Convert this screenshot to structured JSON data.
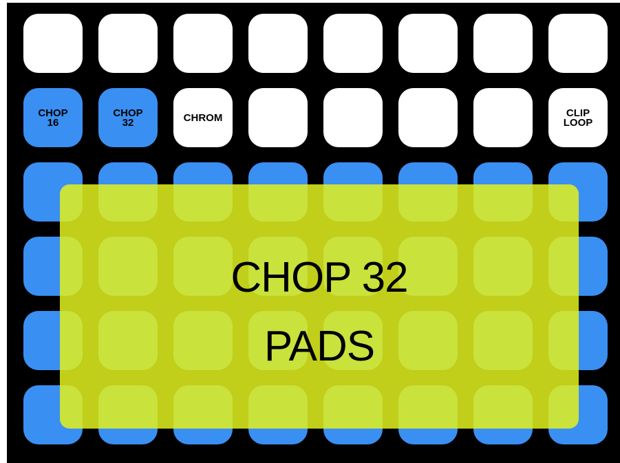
{
  "colors": {
    "background": "#000000",
    "pad_white": "#ffffff",
    "pad_blue": "#3a8ff2",
    "overlay": "#e1f01e"
  },
  "grid": {
    "columns": 8,
    "rows": 6,
    "pads": [
      [
        {
          "label": "",
          "color": "white"
        },
        {
          "label": "",
          "color": "white"
        },
        {
          "label": "",
          "color": "white"
        },
        {
          "label": "",
          "color": "white"
        },
        {
          "label": "",
          "color": "white"
        },
        {
          "label": "",
          "color": "white"
        },
        {
          "label": "",
          "color": "white"
        },
        {
          "label": "",
          "color": "white"
        }
      ],
      [
        {
          "label": "CHOP\n16",
          "color": "blue"
        },
        {
          "label": "CHOP\n32",
          "color": "blue"
        },
        {
          "label": "CHROM",
          "color": "white"
        },
        {
          "label": "",
          "color": "white"
        },
        {
          "label": "",
          "color": "white"
        },
        {
          "label": "",
          "color": "white"
        },
        {
          "label": "",
          "color": "white"
        },
        {
          "label": "CLIP\nLOOP",
          "color": "white"
        }
      ],
      [
        {
          "label": "",
          "color": "blue"
        },
        {
          "label": "",
          "color": "blue"
        },
        {
          "label": "",
          "color": "blue"
        },
        {
          "label": "",
          "color": "blue"
        },
        {
          "label": "",
          "color": "blue"
        },
        {
          "label": "",
          "color": "blue"
        },
        {
          "label": "",
          "color": "blue"
        },
        {
          "label": "",
          "color": "blue"
        }
      ],
      [
        {
          "label": "",
          "color": "blue"
        },
        {
          "label": "",
          "color": "blue"
        },
        {
          "label": "",
          "color": "blue"
        },
        {
          "label": "",
          "color": "blue"
        },
        {
          "label": "",
          "color": "blue"
        },
        {
          "label": "",
          "color": "blue"
        },
        {
          "label": "",
          "color": "blue"
        },
        {
          "label": "",
          "color": "blue"
        }
      ],
      [
        {
          "label": "",
          "color": "blue"
        },
        {
          "label": "",
          "color": "blue"
        },
        {
          "label": "",
          "color": "blue"
        },
        {
          "label": "",
          "color": "blue"
        },
        {
          "label": "",
          "color": "blue"
        },
        {
          "label": "",
          "color": "blue"
        },
        {
          "label": "",
          "color": "blue"
        },
        {
          "label": "",
          "color": "blue"
        }
      ],
      [
        {
          "label": "",
          "color": "blue"
        },
        {
          "label": "",
          "color": "blue"
        },
        {
          "label": "",
          "color": "blue"
        },
        {
          "label": "",
          "color": "blue"
        },
        {
          "label": "",
          "color": "blue"
        },
        {
          "label": "",
          "color": "blue"
        },
        {
          "label": "",
          "color": "blue"
        },
        {
          "label": "",
          "color": "blue"
        }
      ]
    ]
  },
  "overlay": {
    "line1": "CHOP 32",
    "line2": "PADS"
  }
}
